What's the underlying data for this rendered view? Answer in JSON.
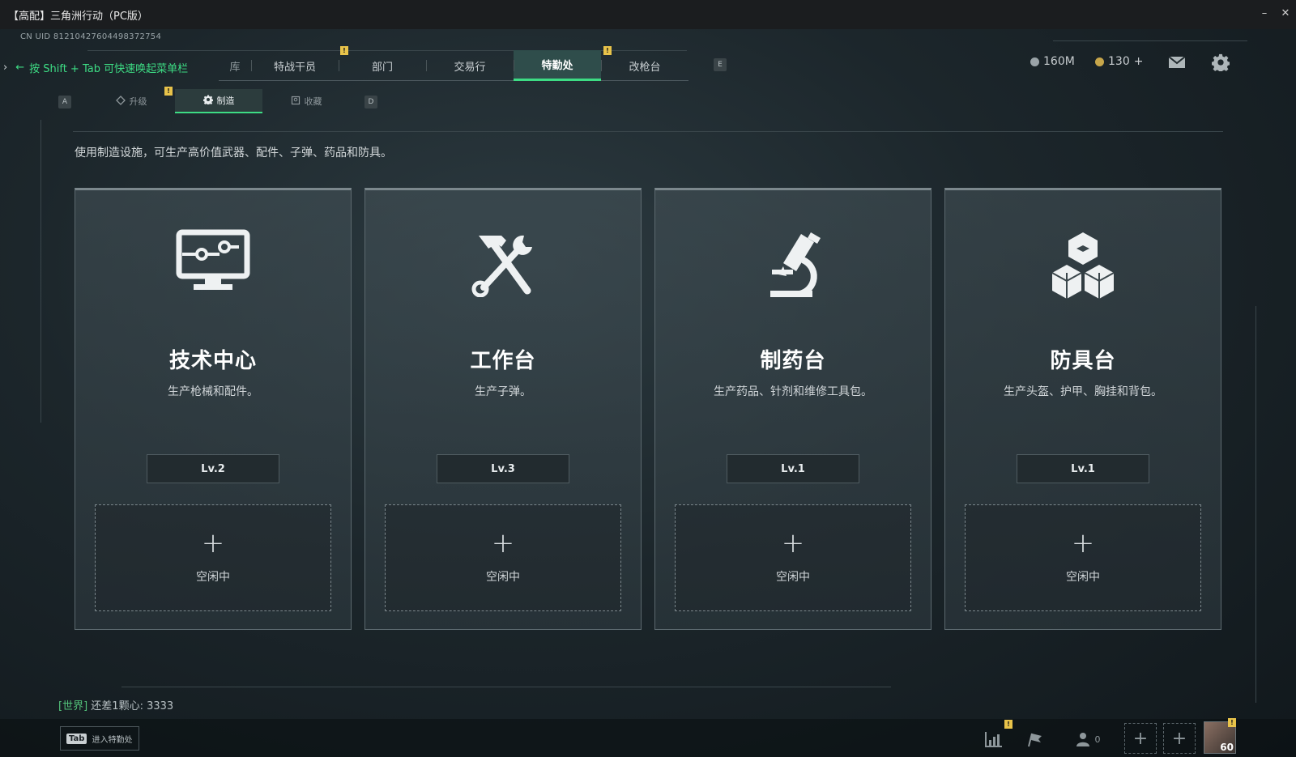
{
  "window": {
    "title": "【高配】三角洲行动（PC版）",
    "minimize": "–",
    "close": "✕"
  },
  "uid": "CN UID 8121042760449837275­4",
  "hint": {
    "chevron": "›",
    "arrow": "←",
    "text": "按 Shift + Tab 可快速唤起菜单栏"
  },
  "topnav": {
    "partial_tab": "库",
    "tabs": [
      {
        "label": "特战干员"
      },
      {
        "label": "部门"
      },
      {
        "label": "交易行"
      },
      {
        "label": "特勤处",
        "active": true
      },
      {
        "label": "改枪台"
      }
    ],
    "key_e": "E",
    "badge": "!"
  },
  "currency": {
    "silver": "160M",
    "gold": "130",
    "gold_add": "+"
  },
  "subtabs": {
    "key_a": "A",
    "key_d": "D",
    "items": [
      {
        "label": "升级",
        "icon": "upgrade-icon"
      },
      {
        "label": "制造",
        "icon": "gear-icon",
        "active": true
      },
      {
        "label": "收藏",
        "icon": "collection-icon"
      }
    ]
  },
  "description": "使用制造设施，可生产高价值武器、配件、子弹、药品和防具。",
  "cards": [
    {
      "title": "技术中心",
      "subtitle": "生产枪械和配件。",
      "level": "Lv.2",
      "slot_plus": "+",
      "slot_status": "空闲中",
      "icon": "monitor-icon"
    },
    {
      "title": "工作台",
      "subtitle": "生产子弹。",
      "level": "Lv.3",
      "slot_plus": "+",
      "slot_status": "空闲中",
      "icon": "hammer-wrench-icon"
    },
    {
      "title": "制药台",
      "subtitle": "生产药品、针剂和维修工具包。",
      "level": "Lv.1",
      "slot_plus": "+",
      "slot_status": "空闲中",
      "icon": "microscope-icon"
    },
    {
      "title": "防具台",
      "subtitle": "生产头盔、护甲、胸挂和背包。",
      "level": "Lv.1",
      "slot_plus": "+",
      "slot_status": "空闲中",
      "icon": "cubes-icon"
    }
  ],
  "chat": {
    "channel": "[世界]",
    "text": "还差1颗心: ",
    "value": "3333"
  },
  "bottom": {
    "tab_key": "Tab",
    "tab_label": "进入特勤处",
    "friends_count": "0",
    "plus": "+",
    "player_level": "60"
  },
  "colors": {
    "accent_green": "#3ddc84",
    "badge_yellow": "#e8c34a",
    "title_bar": "#1b1d1f"
  }
}
